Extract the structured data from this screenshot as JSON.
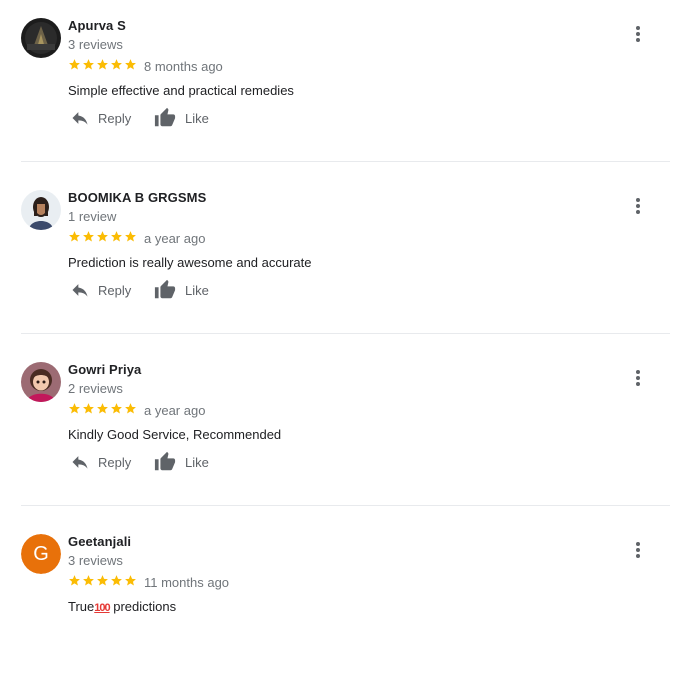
{
  "actions": {
    "reply_label": "Reply",
    "like_label": "Like"
  },
  "colors": {
    "star": "#fbbc04",
    "letter_avatar": "#e8710a"
  },
  "reviews": [
    {
      "name": "Apurva S",
      "review_count": "3 reviews",
      "rating": 5,
      "date": "8 months ago",
      "text": "Simple effective and practical remedies",
      "avatar": "photo-dark"
    },
    {
      "name": "BOOMIKA B GRGSMS",
      "review_count": "1 review",
      "rating": 5,
      "date": "a year ago",
      "text": "Prediction is really awesome and accurate",
      "avatar": "photo-person"
    },
    {
      "name": "Gowri Priya",
      "review_count": "2 reviews",
      "rating": 5,
      "date": "a year ago",
      "text": "Kindly Good Service, Recommended",
      "avatar": "photo-cartoon"
    },
    {
      "name": "Geetanjali",
      "review_count": "3 reviews",
      "rating": 5,
      "date": "11 months ago",
      "text_before": "True",
      "text_emoji": "100",
      "text_after": " predictions",
      "avatar_letter": "G"
    }
  ]
}
